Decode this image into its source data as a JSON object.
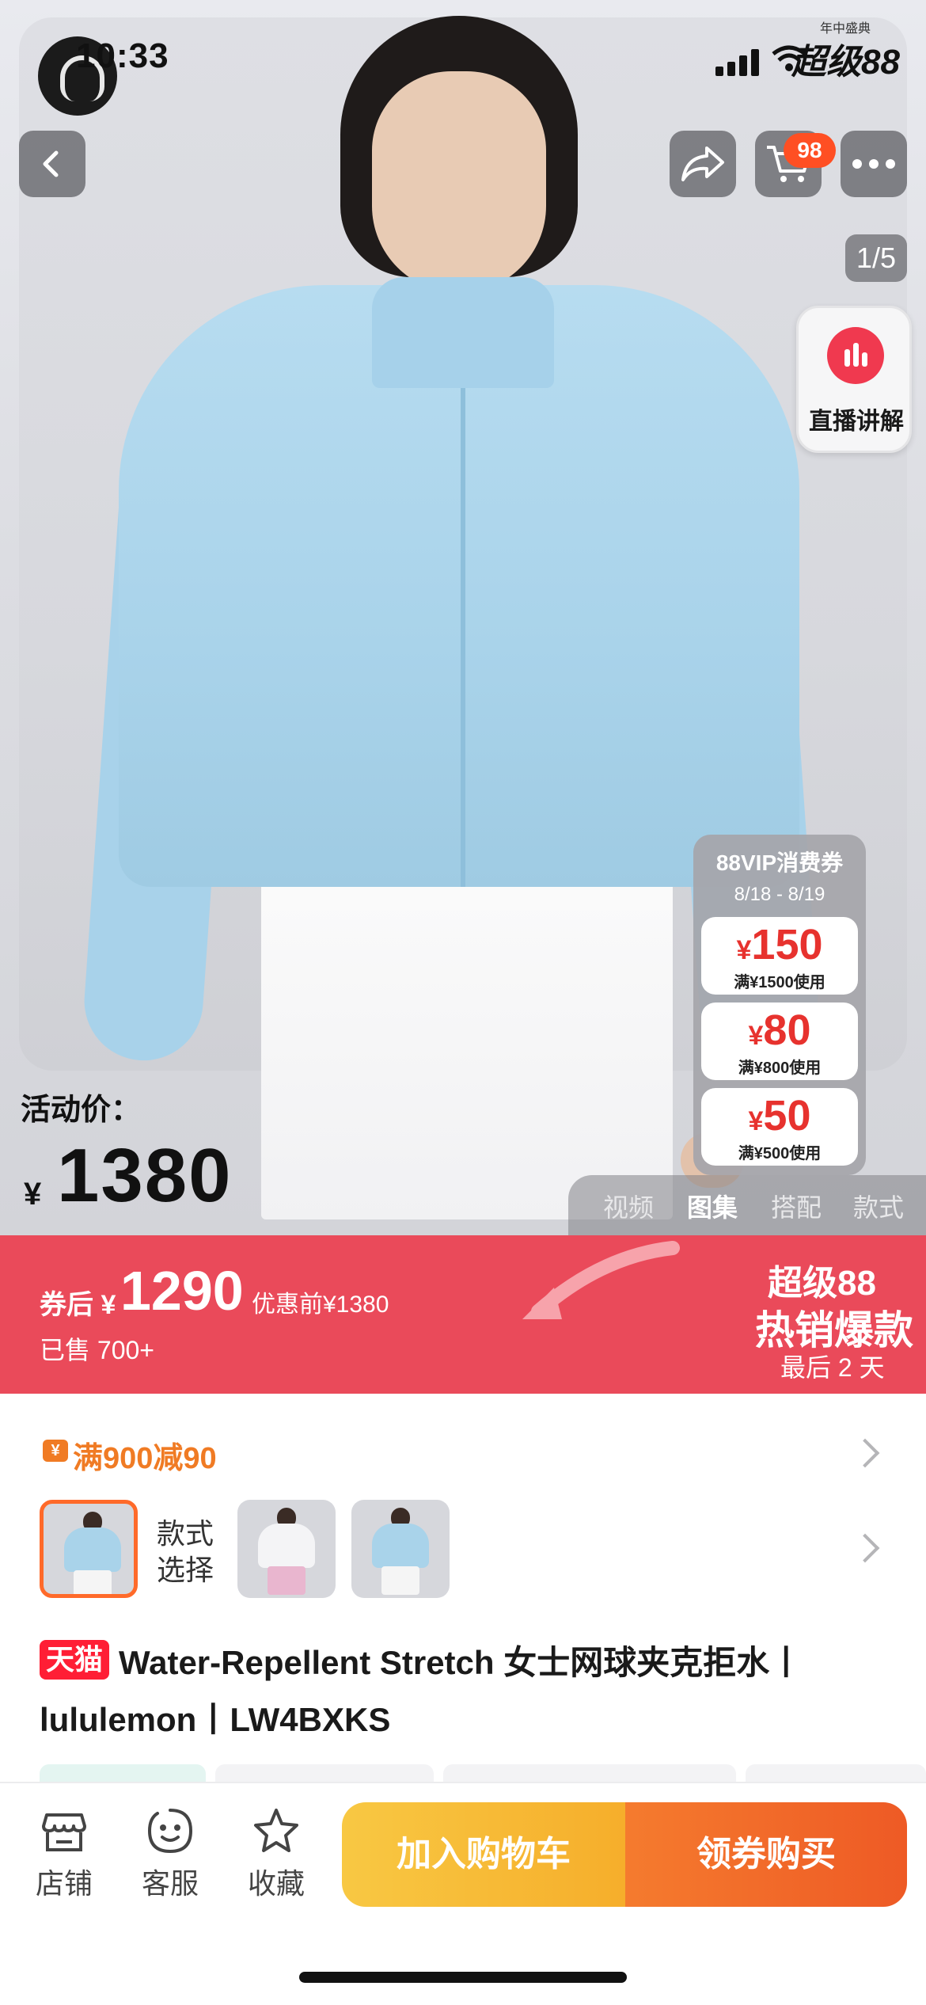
{
  "status_bar": {
    "time": "10:33",
    "badge_small": "年中盛典",
    "badge_big": "超级88"
  },
  "hero": {
    "cart_count": "98",
    "page_counter": "1/5",
    "live_label": "直播讲解",
    "activity_label": "活动价：",
    "activity_currency": "¥",
    "activity_price": "1380",
    "media_tabs": [
      {
        "label": "视频",
        "active": false
      },
      {
        "label": "图集",
        "active": true
      },
      {
        "label": "搭配",
        "active": false
      },
      {
        "label": "款式",
        "active": false
      }
    ]
  },
  "vip": {
    "title": "88VIP消费券",
    "date": "8/18 - 8/19",
    "coupons": [
      {
        "yen": "¥",
        "amount": "150",
        "condition": "满¥1500使用"
      },
      {
        "yen": "¥",
        "amount": "80",
        "condition": "满¥800使用"
      },
      {
        "yen": "¥",
        "amount": "50",
        "condition": "满¥500使用"
      }
    ]
  },
  "promo": {
    "after_label": "券后 ¥",
    "after_price": "1290",
    "before_price": "优惠前¥1380",
    "sold": "已售 700+",
    "right_line1": "超级88",
    "right_line2": "热销爆款",
    "right_line3": "最后 2 天"
  },
  "discount": {
    "icon": "¥",
    "text": "满900减90"
  },
  "style_select": {
    "label_line1": "款式",
    "label_line2": "选择"
  },
  "product": {
    "tag": "天猫",
    "title": "Water-Repellent Stretch 女士网球夹克拒水丨lululemon丨LW4BXKS"
  },
  "bottom_bar": {
    "tabs": [
      {
        "label": "店铺",
        "icon": "store-icon"
      },
      {
        "label": "客服",
        "icon": "chat-face-icon"
      },
      {
        "label": "收藏",
        "icon": "star-icon"
      }
    ],
    "add_to_cart": "加入购物车",
    "buy": "领券购买"
  },
  "colors": {
    "promo_red": "#ea4a5a",
    "accent_orange": "#f07b24",
    "cart_yellow": "#f8c843",
    "buy_orange": "#ee5a25",
    "tmall_red": "#ff1e35",
    "jacket_blue": "#a9d3ea"
  }
}
